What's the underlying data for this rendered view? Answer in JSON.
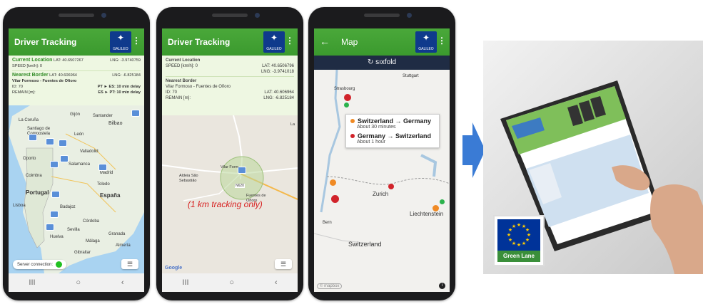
{
  "colors": {
    "appbar_green": "#3b9a2e",
    "info_bg": "#eef7e2",
    "galileo_blue": "#0f3a8c",
    "sixfold_navy": "#1f2c44",
    "arrow_blue": "#3a7bd5",
    "eu_blue": "#003399",
    "note_red": "#d72020"
  },
  "phone1": {
    "title": "Driver Tracking",
    "galileo_label": "GALILEO",
    "menu_icon": "kebab-icon",
    "current_location": {
      "heading": "Current Location",
      "lat": "LAT: 40.6507267",
      "lng": "LNG: -3.9740759",
      "speed": "SPEED [km/h]: 0"
    },
    "nearest_border": {
      "heading": "Nearest Border",
      "lat": "LAT: 40.606964",
      "lng": "LNG: -6.825184",
      "name": "Vilar Formoso - Fuentes de Oñoro",
      "id": "ID:",
      "id_value": "70",
      "pt_es": "PT ► ES: 10 min delay",
      "remain": "REMAIN [m]:",
      "es_pt": "ES ► PT: 10 min delay"
    },
    "map_labels": [
      "Gijón",
      "Santander",
      "Bilbao",
      "La Coruña",
      "Santiago de Compostela",
      "León",
      "Valladolid",
      "Oporto",
      "Salamanca",
      "Coimbra",
      "Madrid",
      "Toledo",
      "Portugal",
      "España",
      "Lisboa",
      "Badajoz",
      "Córdoba",
      "Sevilla",
      "Huelva",
      "Málaga",
      "Granada",
      "Almería",
      "Gibraltar"
    ],
    "server_label": "Server connection:",
    "nav": [
      "III",
      "○",
      "‹"
    ]
  },
  "phone2": {
    "title": "Driver Tracking",
    "galileo_label": "GALILEO",
    "current_location": {
      "heading": "Current Location",
      "speed": "SPEED [km/h]: 0",
      "lat": "LAT: 40.6506796",
      "lng": "LNG: -3.9741018"
    },
    "nearest_border": {
      "heading": "Nearest Border",
      "name": "Vilar Formoso - Fuentes de Oñoro",
      "id": "ID:",
      "id_value": "70",
      "lat": "LAT: 40.606964",
      "remain": "REMAIN [m]:",
      "lng": "LNG: -6.825184"
    },
    "map_labels": [
      "Aldeia São Sebastião",
      "Vilar Form",
      "N620",
      "Fuentes de Oñoro",
      "La"
    ],
    "tracking_note": "(1 km tracking only)",
    "google_label": "Google",
    "nav": [
      "III",
      "○",
      "‹"
    ]
  },
  "phone3": {
    "back_icon": "back-arrow-icon",
    "title": "Map",
    "galileo_label": "GALILEO",
    "brand": "↻ sıxfold",
    "map_labels": [
      "Stuttgart",
      "Strasbourg",
      "Zurich",
      "Liechtenstein",
      "Bern",
      "Switzerland"
    ],
    "popup": {
      "route1": "Switzerland → Germany",
      "route1_time": "About 30 minutes",
      "route2": "Germany → Switzerland",
      "route2_time": "About 1 hour"
    },
    "mapbox_label": "© mapbox",
    "info_label": "i"
  },
  "eu_badge": {
    "label": "Green Lane"
  }
}
